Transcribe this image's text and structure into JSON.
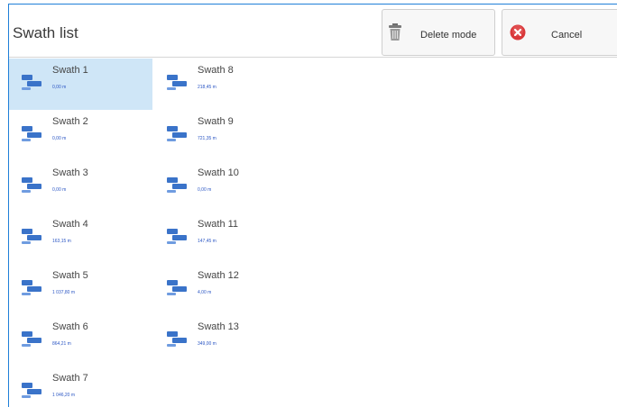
{
  "header": {
    "title": "Swath list",
    "delete_mode_label": "Delete mode",
    "cancel_label": "Cancel"
  },
  "colors": {
    "accent": "#1f7fd8",
    "selected_bg": "#cfe6f7",
    "swath_icon": "#3a73c9",
    "cancel_icon": "#d9383a"
  },
  "icons": {
    "delete": "trash-icon",
    "cancel": "cancel-icon",
    "swath": "swath-icon"
  },
  "swaths": [
    {
      "name": "Swath 1",
      "distance": "0,00 m",
      "selected": true
    },
    {
      "name": "Swath 2",
      "distance": "0,00 m"
    },
    {
      "name": "Swath 3",
      "distance": "0,00 m"
    },
    {
      "name": "Swath 4",
      "distance": "163,15 m"
    },
    {
      "name": "Swath 5",
      "distance": "1 037,80 m"
    },
    {
      "name": "Swath 6",
      "distance": "864,21 m"
    },
    {
      "name": "Swath 7",
      "distance": "1 046,20 m"
    },
    {
      "name": "Swath 8",
      "distance": "218,45 m"
    },
    {
      "name": "Swath 9",
      "distance": "721,35 m"
    },
    {
      "name": "Swath 10",
      "distance": "0,00 m"
    },
    {
      "name": "Swath 11",
      "distance": "147,45 m"
    },
    {
      "name": "Swath 12",
      "distance": "4,00 m"
    },
    {
      "name": "Swath 13",
      "distance": "349,00 m"
    }
  ]
}
